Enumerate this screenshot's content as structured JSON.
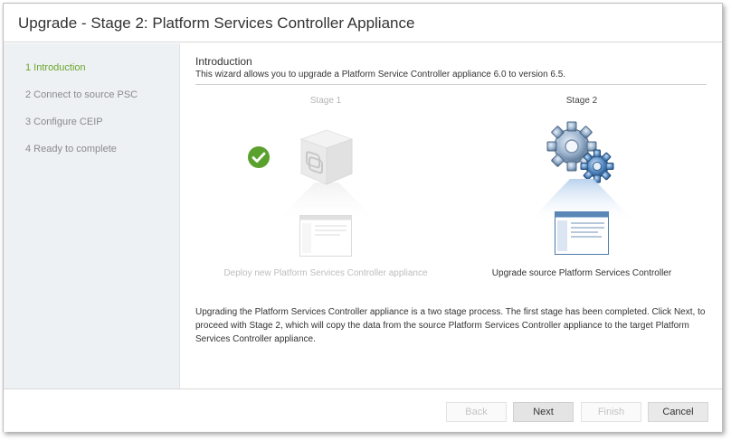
{
  "window": {
    "title": "Upgrade - Stage 2: Platform Services Controller Appliance"
  },
  "sidebar": {
    "steps": [
      {
        "label": "1 Introduction",
        "active": true
      },
      {
        "label": "2 Connect to source PSC",
        "active": false
      },
      {
        "label": "3 Configure CEIP",
        "active": false
      },
      {
        "label": "4 Ready to complete",
        "active": false
      }
    ]
  },
  "main": {
    "heading": "Introduction",
    "description": "This wizard allows you to upgrade a Platform Service Controller appliance 6.0 to version 6.5.",
    "stage1": {
      "label": "Stage 1",
      "caption": "Deploy new Platform Services Controller appliance",
      "status": "completed"
    },
    "stage2": {
      "label": "Stage 2",
      "caption": "Upgrade source Platform Services Controller"
    },
    "paragraph": "Upgrading the Platform Services Controller appliance is a two stage process. The first stage has been completed. Click Next, to proceed with Stage 2, which will copy the data from the source Platform Services Controller appliance to the target Platform Services Controller appliance."
  },
  "footer": {
    "back_label": "Back",
    "next_label": "Next",
    "finish_label": "Finish",
    "cancel_label": "Cancel"
  },
  "colors": {
    "accent_green": "#6ca62c",
    "check_green": "#5aa02c",
    "sidebar_bg": "#eef1f4",
    "gear_blue": "#5b8fc7"
  },
  "icons": {
    "stage1_icon": "appliance-box-icon",
    "stage1_status_icon": "check-circle-icon",
    "stage1_screen_icon": "window-screen-icon",
    "stage2_icon": "gears-icon",
    "stage2_screen_icon": "window-screen-icon"
  }
}
